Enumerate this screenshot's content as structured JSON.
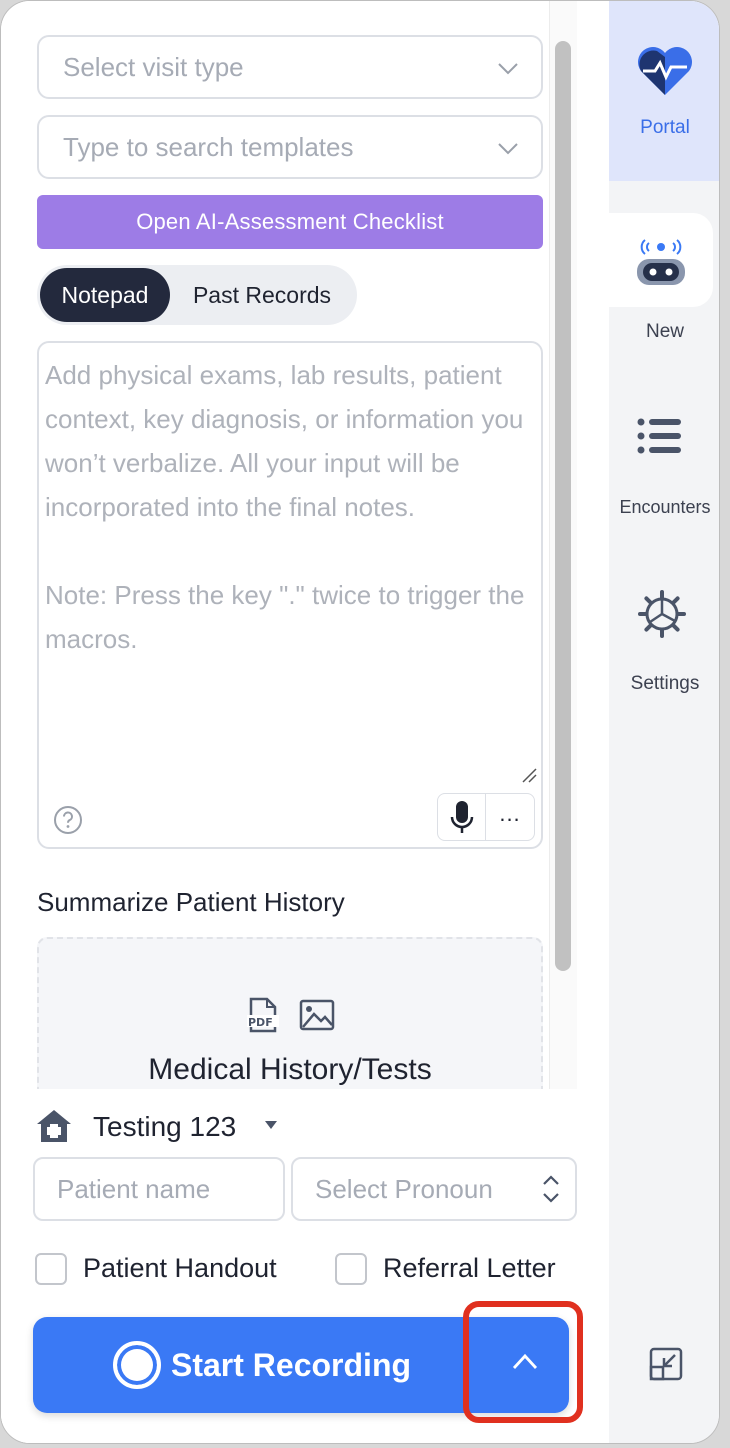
{
  "visit_type": {
    "placeholder": "Select visit type"
  },
  "templates": {
    "placeholder": "Type to search templates"
  },
  "ai_checklist_button": "Open AI-Assessment Checklist",
  "tabs": [
    {
      "label": "Notepad",
      "active": true
    },
    {
      "label": "Past Records",
      "active": false
    }
  ],
  "notepad": {
    "placeholder": "Add physical exams, lab results, patient context, key diagnosis, or information you won’t verbalize. All your input will be incorporated into the final notes.\n\nNote: Press the key \".\" twice to trigger the macros.",
    "more_label": "..."
  },
  "history": {
    "title": "Summarize Patient History",
    "dropzone_title": "Medical History/Tests",
    "icons": [
      "pdf-icon",
      "image-icon"
    ]
  },
  "clinic": {
    "name": "Testing 123"
  },
  "patient": {
    "name_placeholder": "Patient name",
    "pronoun_placeholder": "Select Pronoun"
  },
  "options": {
    "handout_label": "Patient Handout",
    "handout_checked": false,
    "referral_label": "Referral Letter",
    "referral_checked": false
  },
  "record": {
    "label": "Start Recording"
  },
  "sidebar": {
    "items": [
      {
        "label": "Portal",
        "icon": "heart-pulse-icon",
        "active": true
      },
      {
        "label": "New",
        "icon": "robot-icon",
        "active": false
      },
      {
        "label": "Encounters",
        "icon": "list-icon",
        "active": false
      },
      {
        "label": "Settings",
        "icon": "gear-icon",
        "active": false
      }
    ],
    "collapse_icon": "collapse-icon"
  },
  "colors": {
    "primary": "#3a79f5",
    "ai_button": "#9d7ce6",
    "tab_active": "#23293d",
    "highlight": "#e0301f",
    "portal_bg": "#dfe5fb"
  }
}
